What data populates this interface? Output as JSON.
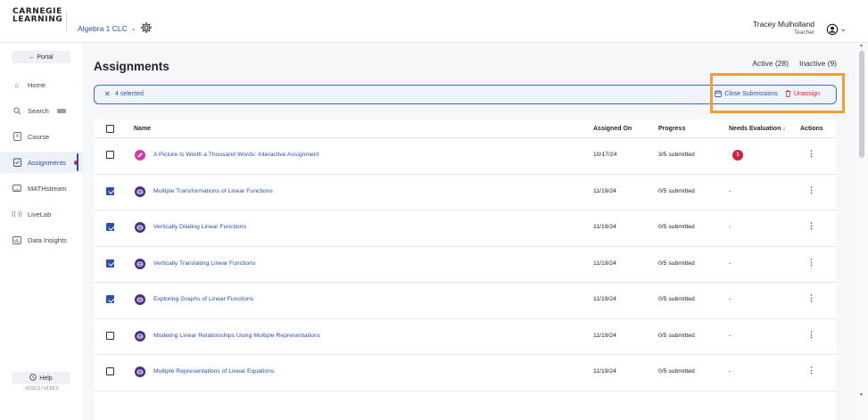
{
  "header": {
    "logo_line1": "CARNEGIE",
    "logo_line2": "LEARNING",
    "class_name": "Algebra 1 CLC",
    "user_name": "Tracey Mulholland",
    "user_role": "Teacher"
  },
  "sidebar": {
    "portal_label": "← Portal",
    "items": [
      {
        "label": "Home",
        "icon": "home-icon"
      },
      {
        "label": "Search",
        "icon": "search-icon"
      },
      {
        "label": "Course",
        "icon": "course-icon"
      },
      {
        "label": "Assignments",
        "icon": "assignments-icon"
      },
      {
        "label": "MATHstream",
        "icon": "video-icon"
      },
      {
        "label": "LiveLab",
        "icon": "broadcast-icon"
      },
      {
        "label": "Data Insights",
        "icon": "chart-icon"
      }
    ],
    "help_label": "Help",
    "version": "v2.52.2 / v2.52.2"
  },
  "main": {
    "title": "Assignments",
    "active_tab": "Active (28)",
    "inactive_tab": "Inactive (9)",
    "selection": {
      "count_label": "4 selected",
      "close_submissions": "Close Submissions",
      "unassign": "Unassign"
    },
    "table": {
      "headers": {
        "name": "Name",
        "assigned_on": "Assigned On",
        "progress": "Progress",
        "needs_evaluation": "Needs Evaluation ↓",
        "actions": "Actions"
      },
      "rows": [
        {
          "checked": false,
          "type": "pencil",
          "name": "A Picture Is Worth a Thousand Words: Interactive Assignment",
          "assigned_on": "10/17/24",
          "progress": "3/5 submitted",
          "needs_evaluation": "1"
        },
        {
          "checked": true,
          "type": "mathia",
          "name": "Multiple Transformations of Linear Functions",
          "assigned_on": "11/19/24",
          "progress": "0/5 submitted",
          "needs_evaluation": "-"
        },
        {
          "checked": true,
          "type": "mathia",
          "name": "Vertically Dilating Linear Functions",
          "assigned_on": "11/19/24",
          "progress": "0/5 submitted",
          "needs_evaluation": "-"
        },
        {
          "checked": true,
          "type": "mathia",
          "name": "Vertically Translating Linear Functions",
          "assigned_on": "11/19/24",
          "progress": "0/5 submitted",
          "needs_evaluation": "-"
        },
        {
          "checked": true,
          "type": "mathia",
          "name": "Exploring Graphs of Linear Functions",
          "assigned_on": "11/19/24",
          "progress": "0/5 submitted",
          "needs_evaluation": "-"
        },
        {
          "checked": false,
          "type": "mathia",
          "name": "Modeling Linear Relationships Using Multiple Representations",
          "assigned_on": "11/19/24",
          "progress": "0/5 submitted",
          "needs_evaluation": "-"
        },
        {
          "checked": false,
          "type": "mathia",
          "name": "Multiple Representations of Linear Equations",
          "assigned_on": "11/19/24",
          "progress": "0/5 submitted",
          "needs_evaluation": "-"
        }
      ]
    }
  },
  "colors": {
    "accent": "#2e4fa8",
    "danger": "#d31f3a",
    "highlight": "#f0a02d"
  }
}
